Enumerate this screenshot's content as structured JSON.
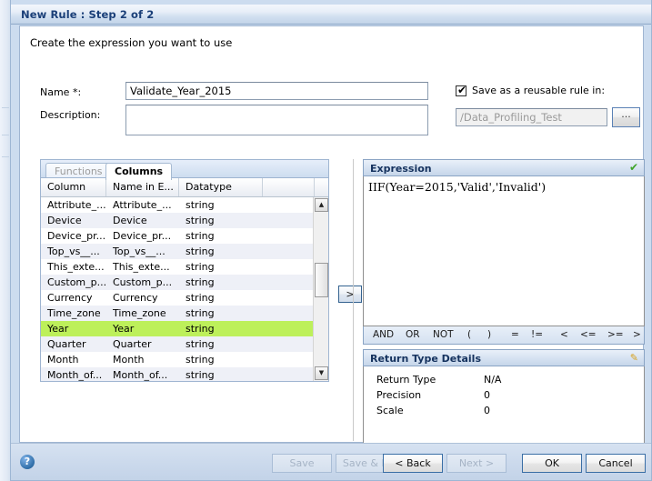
{
  "window": {
    "title": "New Rule : Step 2 of 2",
    "subtitle": "Create the expression you want to use"
  },
  "form": {
    "name_label": "Name *:",
    "name_value": "Validate_Year_2015",
    "description_label": "Description:",
    "description_value": "",
    "reusable_checkbox_label": "Save as a reusable rule in:",
    "reusable_checked": true,
    "reusable_check_glyph": "✔",
    "path_value": "/Data_Profiling_Test",
    "browse_label": "..."
  },
  "left_panel": {
    "tabs": [
      {
        "label": "Functions",
        "active": false
      },
      {
        "label": "Columns",
        "active": true
      }
    ],
    "grid": {
      "headers": [
        "Column",
        "Name in E...",
        "Datatype",
        ""
      ],
      "rows": [
        {
          "column": "Attribute_...",
          "name_in_e": "Attribute_...",
          "datatype": "string",
          "selected": false
        },
        {
          "column": "Device",
          "name_in_e": "Device",
          "datatype": "string",
          "selected": false
        },
        {
          "column": "Device_pr...",
          "name_in_e": "Device_pr...",
          "datatype": "string",
          "selected": false
        },
        {
          "column": "Top_vs__...",
          "name_in_e": "Top_vs__...",
          "datatype": "string",
          "selected": false
        },
        {
          "column": "This_exte...",
          "name_in_e": "This_exte...",
          "datatype": "string",
          "selected": false
        },
        {
          "column": "Custom_p...",
          "name_in_e": "Custom_p...",
          "datatype": "string",
          "selected": false
        },
        {
          "column": "Currency",
          "name_in_e": "Currency",
          "datatype": "string",
          "selected": false
        },
        {
          "column": "Time_zone",
          "name_in_e": "Time_zone",
          "datatype": "string",
          "selected": false
        },
        {
          "column": "Year",
          "name_in_e": "Year",
          "datatype": "string",
          "selected": true
        },
        {
          "column": "Quarter",
          "name_in_e": "Quarter",
          "datatype": "string",
          "selected": false
        },
        {
          "column": "Month",
          "name_in_e": "Month",
          "datatype": "string",
          "selected": false
        },
        {
          "column": "Month_of...",
          "name_in_e": "Month_of...",
          "datatype": "string",
          "selected": false
        }
      ],
      "scrollbar": {
        "up_glyph": "▲",
        "down_glyph": "▼"
      },
      "selected_row_color": "#bdf05a"
    },
    "transfer_button_label": ">"
  },
  "expression_panel": {
    "header": "Expression",
    "valid_glyph": "✔",
    "value": "IIF(Year=2015,'Valid','Invalid')",
    "operators": [
      "AND",
      "OR",
      "NOT",
      "(",
      ")",
      "=",
      "!=",
      "<",
      "<=",
      ">=",
      ">"
    ]
  },
  "return_type_details": {
    "header": "Return Type Details",
    "edit_glyph": "✎",
    "rows": [
      {
        "key": "Return Type",
        "value": "N/A"
      },
      {
        "key": "Precision",
        "value": "0"
      },
      {
        "key": "Scale",
        "value": "0"
      }
    ]
  },
  "footer": {
    "help_glyph": "?",
    "buttons": [
      {
        "label": "Save",
        "enabled": false
      },
      {
        "label": "Save & R",
        "enabled": false
      },
      {
        "label": "< Back",
        "enabled": true
      },
      {
        "label": "Next >",
        "enabled": false
      },
      {
        "label": "OK",
        "enabled": true
      },
      {
        "label": "Cancel",
        "enabled": true
      }
    ]
  },
  "colors": {
    "title_text": "#1a3f78",
    "panel_header_text": "#15325e",
    "valid_check": "#3fa428",
    "selection": "#bdf05a"
  }
}
